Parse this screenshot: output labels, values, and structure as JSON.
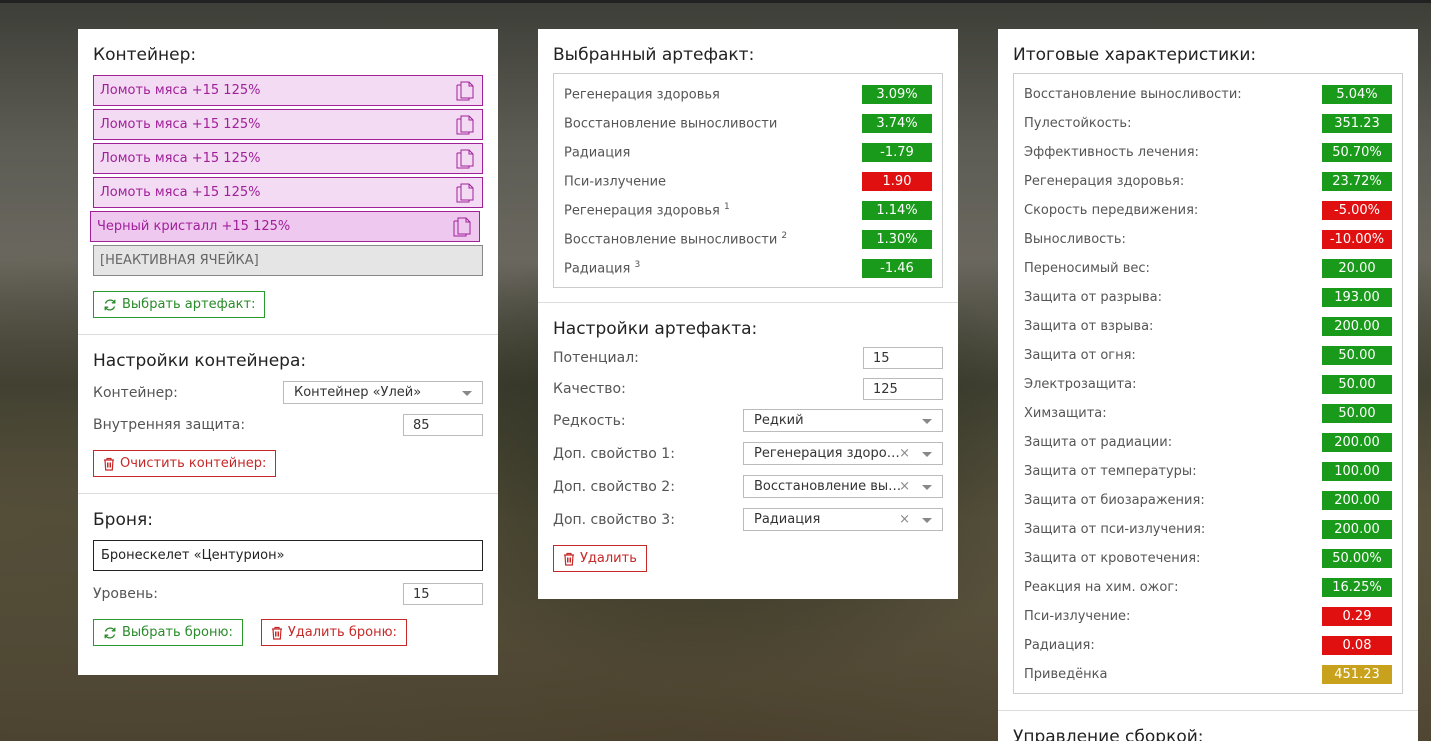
{
  "colors": {
    "green": "#1a9a1a",
    "red": "#e01010",
    "gold": "#c8a21c",
    "slot": "#a0209a"
  },
  "container": {
    "title": "Контейнер:",
    "slots": [
      {
        "label": "Ломоть мяса +15 125%"
      },
      {
        "label": "Ломоть мяса +15 125%"
      },
      {
        "label": "Ломоть мяса +15 125%"
      },
      {
        "label": "Ломоть мяса +15 125%"
      },
      {
        "label": "Черный кристалл +15 125%"
      }
    ],
    "inactive_slot": "[НЕАКТИВНАЯ ЯЧЕЙКА]",
    "select_button": "Выбрать артефакт:"
  },
  "container_settings": {
    "title": "Настройки контейнера:",
    "container_label": "Контейнер:",
    "container_value": "Контейнер «Улей»",
    "protection_label": "Внутренняя защита:",
    "protection_value": "85",
    "clear_button": "Очистить контейнер:"
  },
  "armor": {
    "title": "Броня:",
    "name": "Бронескелет «Центурион»",
    "level_label": "Уровень:",
    "level_value": "15",
    "select_button": "Выбрать броню:",
    "delete_button": "Удалить броню:"
  },
  "selected_artifact": {
    "title": "Выбранный артефакт:",
    "stats": [
      {
        "name": "Регенерация здоровья",
        "sup": "",
        "value": "3.09%",
        "color": "g"
      },
      {
        "name": "Восстановление выносливости",
        "sup": "",
        "value": "3.74%",
        "color": "g"
      },
      {
        "name": "Радиация",
        "sup": "",
        "value": "-1.79",
        "color": "g"
      },
      {
        "name": "Пси-излучение",
        "sup": "",
        "value": "1.90",
        "color": "r"
      },
      {
        "name": "Регенерация здоровья",
        "sup": "1",
        "value": "1.14%",
        "color": "g"
      },
      {
        "name": "Восстановление выносливости",
        "sup": "2",
        "value": "1.30%",
        "color": "g"
      },
      {
        "name": "Радиация",
        "sup": "3",
        "value": "-1.46",
        "color": "g"
      }
    ]
  },
  "artifact_settings": {
    "title": "Настройки артефакта:",
    "potential_label": "Потенциал:",
    "potential_value": "15",
    "quality_label": "Качество:",
    "quality_value": "125",
    "rarity_label": "Редкость:",
    "rarity_value": "Редкий",
    "prop1_label": "Доп. свойство 1:",
    "prop1_value": "Регенерация здоровья",
    "prop2_label": "Доп. свойство 2:",
    "prop2_value": "Восстановление выносливости",
    "prop3_label": "Доп. свойство 3:",
    "prop3_value": "Радиация",
    "delete_button": "Удалить"
  },
  "totals": {
    "title": "Итоговые характеристики:",
    "stats": [
      {
        "name": "Восстановление выносливости:",
        "value": "5.04%",
        "color": "g"
      },
      {
        "name": "Пулестойкость:",
        "value": "351.23",
        "color": "g"
      },
      {
        "name": "Эффективность лечения:",
        "value": "50.70%",
        "color": "g"
      },
      {
        "name": "Регенерация здоровья:",
        "value": "23.72%",
        "color": "g"
      },
      {
        "name": "Скорость передвижения:",
        "value": "-5.00%",
        "color": "r"
      },
      {
        "name": "Выносливость:",
        "value": "-10.00%",
        "color": "r"
      },
      {
        "name": "Переносимый вес:",
        "value": "20.00",
        "color": "g"
      },
      {
        "name": "Защита от разрыва:",
        "value": "193.00",
        "color": "g"
      },
      {
        "name": "Защита от взрыва:",
        "value": "200.00",
        "color": "g"
      },
      {
        "name": "Защита от огня:",
        "value": "50.00",
        "color": "g"
      },
      {
        "name": "Электрозащита:",
        "value": "50.00",
        "color": "g"
      },
      {
        "name": "Химзащита:",
        "value": "50.00",
        "color": "g"
      },
      {
        "name": "Защита от радиации:",
        "value": "200.00",
        "color": "g"
      },
      {
        "name": "Защита от температуры:",
        "value": "100.00",
        "color": "g"
      },
      {
        "name": "Защита от биозаражения:",
        "value": "200.00",
        "color": "g"
      },
      {
        "name": "Защита от пси-излучения:",
        "value": "200.00",
        "color": "g"
      },
      {
        "name": "Защита от кровотечения:",
        "value": "50.00%",
        "color": "g"
      },
      {
        "name": "Реакция на хим. ожог:",
        "value": "16.25%",
        "color": "g"
      },
      {
        "name": "Пси-излучение:",
        "value": "0.29",
        "color": "r"
      },
      {
        "name": "Радиация:",
        "value": "0.08",
        "color": "r"
      },
      {
        "name": "Приведёнка",
        "value": "451.23",
        "color": "y"
      }
    ]
  },
  "build_management": {
    "title": "Управление сборкой:"
  }
}
